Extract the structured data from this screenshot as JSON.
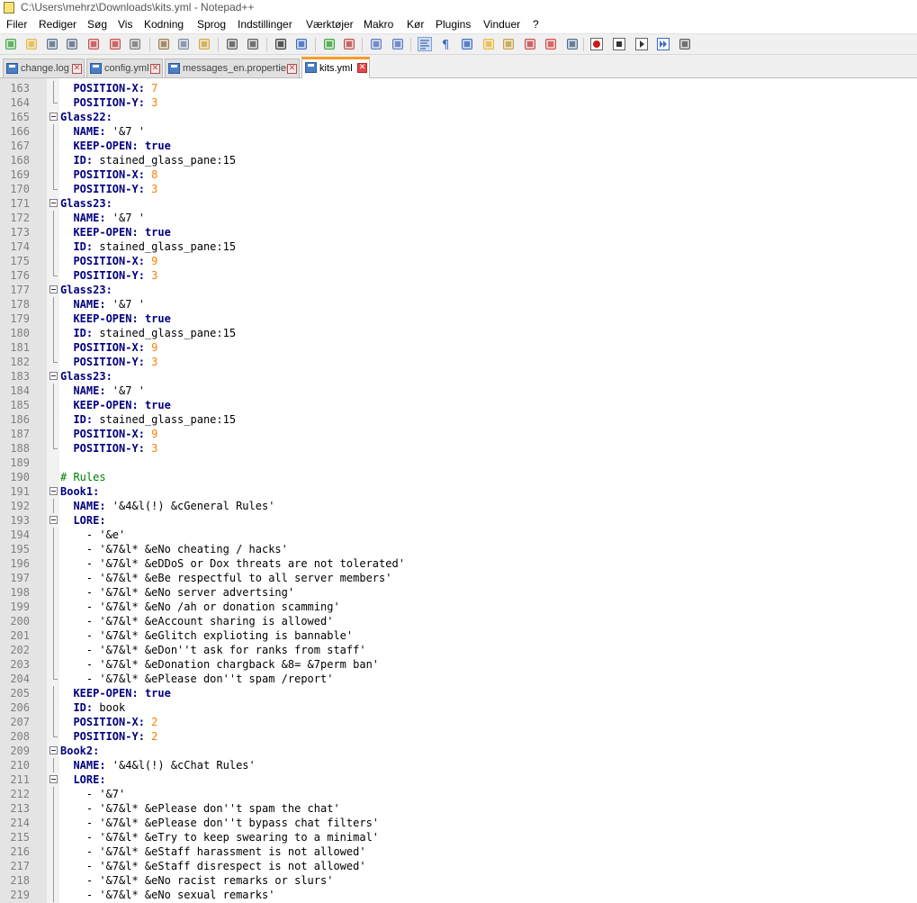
{
  "window": {
    "title": "C:\\Users\\mehrz\\Downloads\\kits.yml - Notepad++"
  },
  "menu": [
    "Filer",
    "Rediger",
    "Søg",
    "Vis",
    "Kodning",
    "Sprog",
    "Indstillinger",
    "Værktøjer",
    "Makro",
    "Kør",
    "Plugins",
    "Vinduer",
    "?"
  ],
  "toolbar": {
    "buttons": [
      "new-file-icon",
      "open-file-icon",
      "save-icon",
      "save-all-icon",
      "close-icon",
      "close-all-icon",
      "print-icon",
      "cut-icon",
      "copy-icon",
      "paste-icon",
      "undo-icon",
      "redo-icon",
      "find-icon",
      "replace-icon",
      "zoom-in-icon",
      "zoom-out-icon",
      "sync-vertical-icon",
      "sync-horizontal-icon",
      "word-wrap-icon",
      "show-all-characters-icon",
      "indent-guide-icon",
      "user-defined-language-icon",
      "document-map-icon",
      "function-list-icon",
      "folder-as-workspace-icon",
      "monitoring-icon",
      "record-macro-icon",
      "stop-recording-icon",
      "playback-macro-icon",
      "run-macro-multiple-icon",
      "save-macro-icon"
    ]
  },
  "tabs": [
    {
      "label": "change.log",
      "active": false
    },
    {
      "label": "config.yml",
      "active": false
    },
    {
      "label": "messages_en.properties",
      "active": false
    },
    {
      "label": "kits.yml",
      "active": true
    }
  ],
  "colors": {
    "keyword": "#000080",
    "number": "#ff8000",
    "comment": "#008000",
    "tab_accent": "#fa9b24",
    "gutter_bg": "#e4e4e4"
  },
  "editor": {
    "lines": [
      {
        "n": "163",
        "fold": "bar",
        "indent": "  ",
        "parts": [
          [
            "k",
            "POSITION-X:"
          ],
          [
            "s",
            " "
          ],
          [
            "n",
            "7"
          ]
        ]
      },
      {
        "n": "164",
        "fold": "end",
        "indent": "  ",
        "parts": [
          [
            "k",
            "POSITION-Y:"
          ],
          [
            "s",
            " "
          ],
          [
            "n",
            "3"
          ]
        ]
      },
      {
        "n": "165",
        "fold": "box",
        "indent": "",
        "parts": [
          [
            "k",
            "Glass22:"
          ]
        ]
      },
      {
        "n": "166",
        "fold": "bar",
        "indent": "  ",
        "parts": [
          [
            "k",
            "NAME:"
          ],
          [
            "s",
            " '&7 '"
          ]
        ]
      },
      {
        "n": "167",
        "fold": "bar",
        "indent": "  ",
        "parts": [
          [
            "k",
            "KEEP-OPEN:"
          ],
          [
            "s",
            " "
          ],
          [
            "b",
            "true"
          ]
        ]
      },
      {
        "n": "168",
        "fold": "bar",
        "indent": "  ",
        "parts": [
          [
            "k",
            "ID:"
          ],
          [
            "s",
            " stained_glass_pane:15"
          ]
        ]
      },
      {
        "n": "169",
        "fold": "bar",
        "indent": "  ",
        "parts": [
          [
            "k",
            "POSITION-X:"
          ],
          [
            "s",
            " "
          ],
          [
            "n",
            "8"
          ]
        ]
      },
      {
        "n": "170",
        "fold": "end",
        "indent": "  ",
        "parts": [
          [
            "k",
            "POSITION-Y:"
          ],
          [
            "s",
            " "
          ],
          [
            "n",
            "3"
          ]
        ]
      },
      {
        "n": "171",
        "fold": "box",
        "indent": "",
        "parts": [
          [
            "k",
            "Glass23:"
          ]
        ]
      },
      {
        "n": "172",
        "fold": "bar",
        "indent": "  ",
        "parts": [
          [
            "k",
            "NAME:"
          ],
          [
            "s",
            " '&7 '"
          ]
        ]
      },
      {
        "n": "173",
        "fold": "bar",
        "indent": "  ",
        "parts": [
          [
            "k",
            "KEEP-OPEN:"
          ],
          [
            "s",
            " "
          ],
          [
            "b",
            "true"
          ]
        ]
      },
      {
        "n": "174",
        "fold": "bar",
        "indent": "  ",
        "parts": [
          [
            "k",
            "ID:"
          ],
          [
            "s",
            " stained_glass_pane:15"
          ]
        ]
      },
      {
        "n": "175",
        "fold": "bar",
        "indent": "  ",
        "parts": [
          [
            "k",
            "POSITION-X:"
          ],
          [
            "s",
            " "
          ],
          [
            "n",
            "9"
          ]
        ]
      },
      {
        "n": "176",
        "fold": "end",
        "indent": "  ",
        "parts": [
          [
            "k",
            "POSITION-Y:"
          ],
          [
            "s",
            " "
          ],
          [
            "n",
            "3"
          ]
        ]
      },
      {
        "n": "177",
        "fold": "box",
        "indent": "",
        "parts": [
          [
            "k",
            "Glass23:"
          ]
        ]
      },
      {
        "n": "178",
        "fold": "bar",
        "indent": "  ",
        "parts": [
          [
            "k",
            "NAME:"
          ],
          [
            "s",
            " '&7 '"
          ]
        ]
      },
      {
        "n": "179",
        "fold": "bar",
        "indent": "  ",
        "parts": [
          [
            "k",
            "KEEP-OPEN:"
          ],
          [
            "s",
            " "
          ],
          [
            "b",
            "true"
          ]
        ]
      },
      {
        "n": "180",
        "fold": "bar",
        "indent": "  ",
        "parts": [
          [
            "k",
            "ID:"
          ],
          [
            "s",
            " stained_glass_pane:15"
          ]
        ]
      },
      {
        "n": "181",
        "fold": "bar",
        "indent": "  ",
        "parts": [
          [
            "k",
            "POSITION-X:"
          ],
          [
            "s",
            " "
          ],
          [
            "n",
            "9"
          ]
        ]
      },
      {
        "n": "182",
        "fold": "end",
        "indent": "  ",
        "parts": [
          [
            "k",
            "POSITION-Y:"
          ],
          [
            "s",
            " "
          ],
          [
            "n",
            "3"
          ]
        ]
      },
      {
        "n": "183",
        "fold": "box",
        "indent": "",
        "parts": [
          [
            "k",
            "Glass23:"
          ]
        ]
      },
      {
        "n": "184",
        "fold": "bar",
        "indent": "  ",
        "parts": [
          [
            "k",
            "NAME:"
          ],
          [
            "s",
            " '&7 '"
          ]
        ]
      },
      {
        "n": "185",
        "fold": "bar",
        "indent": "  ",
        "parts": [
          [
            "k",
            "KEEP-OPEN:"
          ],
          [
            "s",
            " "
          ],
          [
            "b",
            "true"
          ]
        ]
      },
      {
        "n": "186",
        "fold": "bar",
        "indent": "  ",
        "parts": [
          [
            "k",
            "ID:"
          ],
          [
            "s",
            " stained_glass_pane:15"
          ]
        ]
      },
      {
        "n": "187",
        "fold": "bar",
        "indent": "  ",
        "parts": [
          [
            "k",
            "POSITION-X:"
          ],
          [
            "s",
            " "
          ],
          [
            "n",
            "9"
          ]
        ]
      },
      {
        "n": "188",
        "fold": "end",
        "indent": "  ",
        "parts": [
          [
            "k",
            "POSITION-Y:"
          ],
          [
            "s",
            " "
          ],
          [
            "n",
            "3"
          ]
        ]
      },
      {
        "n": "189",
        "fold": "none",
        "indent": "",
        "parts": []
      },
      {
        "n": "190",
        "fold": "none",
        "indent": "",
        "parts": [
          [
            "c",
            "# Rules"
          ]
        ]
      },
      {
        "n": "191",
        "fold": "box",
        "indent": "",
        "parts": [
          [
            "k",
            "Book1:"
          ]
        ]
      },
      {
        "n": "192",
        "fold": "bar",
        "indent": "  ",
        "parts": [
          [
            "k",
            "NAME:"
          ],
          [
            "s",
            " '&4&l(!) &cGeneral Rules'"
          ]
        ]
      },
      {
        "n": "193",
        "fold": "box",
        "indent": "  ",
        "parts": [
          [
            "k",
            "LORE:"
          ]
        ]
      },
      {
        "n": "194",
        "fold": "bar",
        "indent": "    ",
        "parts": [
          [
            "p",
            "- '&e'"
          ]
        ]
      },
      {
        "n": "195",
        "fold": "bar",
        "indent": "    ",
        "parts": [
          [
            "p",
            "- '&7&l* &eNo cheating / hacks'"
          ]
        ]
      },
      {
        "n": "196",
        "fold": "bar",
        "indent": "    ",
        "parts": [
          [
            "p",
            "- '&7&l* &eDDoS or Dox threats are not tolerated'"
          ]
        ]
      },
      {
        "n": "197",
        "fold": "bar",
        "indent": "    ",
        "parts": [
          [
            "p",
            "- '&7&l* &eBe respectful to all server members'"
          ]
        ]
      },
      {
        "n": "198",
        "fold": "bar",
        "indent": "    ",
        "parts": [
          [
            "p",
            "- '&7&l* &eNo server advertsing'"
          ]
        ]
      },
      {
        "n": "199",
        "fold": "bar",
        "indent": "    ",
        "parts": [
          [
            "p",
            "- '&7&l* &eNo /ah or donation scamming'"
          ]
        ]
      },
      {
        "n": "200",
        "fold": "bar",
        "indent": "    ",
        "parts": [
          [
            "p",
            "- '&7&l* &eAccount sharing is allowed'"
          ]
        ]
      },
      {
        "n": "201",
        "fold": "bar",
        "indent": "    ",
        "parts": [
          [
            "p",
            "- '&7&l* &eGlitch explioting is bannable'"
          ]
        ]
      },
      {
        "n": "202",
        "fold": "bar",
        "indent": "    ",
        "parts": [
          [
            "p",
            "- '&7&l* &eDon''t ask for ranks from staff'"
          ]
        ]
      },
      {
        "n": "203",
        "fold": "bar",
        "indent": "    ",
        "parts": [
          [
            "p",
            "- '&7&l* &eDonation chargback &8= &7perm ban'"
          ]
        ]
      },
      {
        "n": "204",
        "fold": "end",
        "indent": "    ",
        "parts": [
          [
            "p",
            "- '&7&l* &ePlease don''t spam /report'"
          ]
        ]
      },
      {
        "n": "205",
        "fold": "bar",
        "indent": "  ",
        "parts": [
          [
            "k",
            "KEEP-OPEN:"
          ],
          [
            "s",
            " "
          ],
          [
            "b",
            "true"
          ]
        ]
      },
      {
        "n": "206",
        "fold": "bar",
        "indent": "  ",
        "parts": [
          [
            "k",
            "ID:"
          ],
          [
            "s",
            " book"
          ]
        ]
      },
      {
        "n": "207",
        "fold": "bar",
        "indent": "  ",
        "parts": [
          [
            "k",
            "POSITION-X:"
          ],
          [
            "s",
            " "
          ],
          [
            "n",
            "2"
          ]
        ]
      },
      {
        "n": "208",
        "fold": "end",
        "indent": "  ",
        "parts": [
          [
            "k",
            "POSITION-Y:"
          ],
          [
            "s",
            " "
          ],
          [
            "n",
            "2"
          ]
        ]
      },
      {
        "n": "209",
        "fold": "box",
        "indent": "",
        "parts": [
          [
            "k",
            "Book2:"
          ]
        ]
      },
      {
        "n": "210",
        "fold": "bar",
        "indent": "  ",
        "parts": [
          [
            "k",
            "NAME:"
          ],
          [
            "s",
            " '&4&l(!) &cChat Rules'"
          ]
        ]
      },
      {
        "n": "211",
        "fold": "box",
        "indent": "  ",
        "parts": [
          [
            "k",
            "LORE:"
          ]
        ]
      },
      {
        "n": "212",
        "fold": "bar",
        "indent": "    ",
        "parts": [
          [
            "p",
            "- '&7'"
          ]
        ]
      },
      {
        "n": "213",
        "fold": "bar",
        "indent": "    ",
        "parts": [
          [
            "p",
            "- '&7&l* &ePlease don''t spam the chat'"
          ]
        ]
      },
      {
        "n": "214",
        "fold": "bar",
        "indent": "    ",
        "parts": [
          [
            "p",
            "- '&7&l* &ePlease don''t bypass chat filters'"
          ]
        ]
      },
      {
        "n": "215",
        "fold": "bar",
        "indent": "    ",
        "parts": [
          [
            "p",
            "- '&7&l* &eTry to keep swearing to a minimal'"
          ]
        ]
      },
      {
        "n": "216",
        "fold": "bar",
        "indent": "    ",
        "parts": [
          [
            "p",
            "- '&7&l* &eStaff harassment is not allowed'"
          ]
        ]
      },
      {
        "n": "217",
        "fold": "bar",
        "indent": "    ",
        "parts": [
          [
            "p",
            "- '&7&l* &eStaff disrespect is not allowed'"
          ]
        ]
      },
      {
        "n": "218",
        "fold": "bar",
        "indent": "    ",
        "parts": [
          [
            "p",
            "- '&7&l* &eNo racist remarks or slurs'"
          ]
        ]
      },
      {
        "n": "219",
        "fold": "bar",
        "indent": "    ",
        "parts": [
          [
            "p",
            "- '&7&l* &eNo sexual remarks'"
          ]
        ]
      }
    ]
  }
}
